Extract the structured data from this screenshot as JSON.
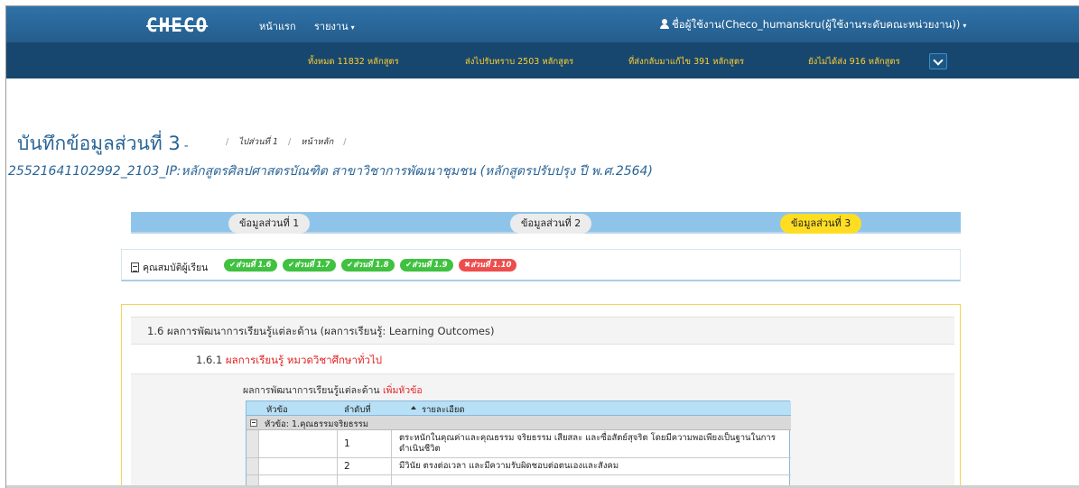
{
  "navbar": {
    "brand": "CHECO",
    "menu": [
      {
        "label": "หน้าแรก"
      },
      {
        "label": "รายงาน",
        "caret": "▾"
      }
    ],
    "user_label": "ชื่อผู้ใช้งาน(Checo_humanskru(ผู้ใช้งานระดับคณะหน่วยงาน))",
    "user_caret": "▾"
  },
  "stats": {
    "total": "ทั้งหมด 11832 หลักสูตร",
    "sent": "ส่งไปรับทราบ 2503 หลักสูตร",
    "returned": "ที่ส่งกลับมาแก้ไข 391 หลักสูตร",
    "pending": "ยังไม่ได้ส่ง 916 หลักสูตร"
  },
  "page": {
    "title": "บันทึกข้อมูลส่วนที่ 3",
    "title_suffix": "-",
    "breadcrumbs": [
      "ไปส่วนที่ 1",
      "หน้าหลัก"
    ],
    "breadcrumb_sep": "/",
    "course": "25521641102992_2103_IP:หลักสูตรศิลปศาสตรบัณฑิต สาขาวิชาการพัฒนาชุมชน (หลักสูตรปรับปรุง ปี พ.ศ.2564)"
  },
  "wizard": {
    "steps": [
      {
        "label": "ข้อมูลส่วนที่ 1",
        "state": "done"
      },
      {
        "label": "ข้อมูลส่วนที่ 2",
        "state": "done"
      },
      {
        "label": "ข้อมูลส่วนที่ 3",
        "state": "active"
      }
    ],
    "active_color": "#ffdd22"
  },
  "sections": {
    "label": "คุณสมบัติผู้เรียน",
    "pills": [
      {
        "label": "✔ส่วนที่ 1.6",
        "status": "ok"
      },
      {
        "label": "✔ส่วนที่ 1.7",
        "status": "ok"
      },
      {
        "label": "✔ส่วนที่ 1.8",
        "status": "ok"
      },
      {
        "label": "✔ส่วนที่ 1.9",
        "status": "ok"
      },
      {
        "label": "✖ส่วนที่ 1.10",
        "status": "error"
      }
    ],
    "ok_color": "#3fc23f",
    "error_color": "#ee4d4d"
  },
  "panel": {
    "heading": "1.6 ผลการพัฒนาการเรียนรู้แต่ละด้าน (ผลการเรียนรู้: Learning Outcomes)",
    "sub_num": "1.6.1",
    "sub_label": "ผลการเรียนรู้ หมวดวิชาศึกษาทั่วไป",
    "add_prefix": "ผลการพัฒนาการเรียนรู้แต่ละด้าน",
    "add_link": "เพิ่มหัวข้อ"
  },
  "grid": {
    "columns": [
      "หัวข้อ",
      "ลำดับที่",
      "รายละเอียด"
    ],
    "group": "หัวข้อ: 1.คุณธรรมจริยธรรม",
    "rows": [
      {
        "num": "1",
        "desc": "ตระหนักในคุณค่าและคุณธรรม จริยธรรม เสียสละ และซื่อสัตย์สุจริต โดยมีความพอเพียงเป็นฐานในการดำเนินชีวิต"
      },
      {
        "num": "2",
        "desc": "มีวินัย ตรงต่อเวลา และมีความรับผิดชอบต่อตนเองและสังคม"
      }
    ]
  }
}
